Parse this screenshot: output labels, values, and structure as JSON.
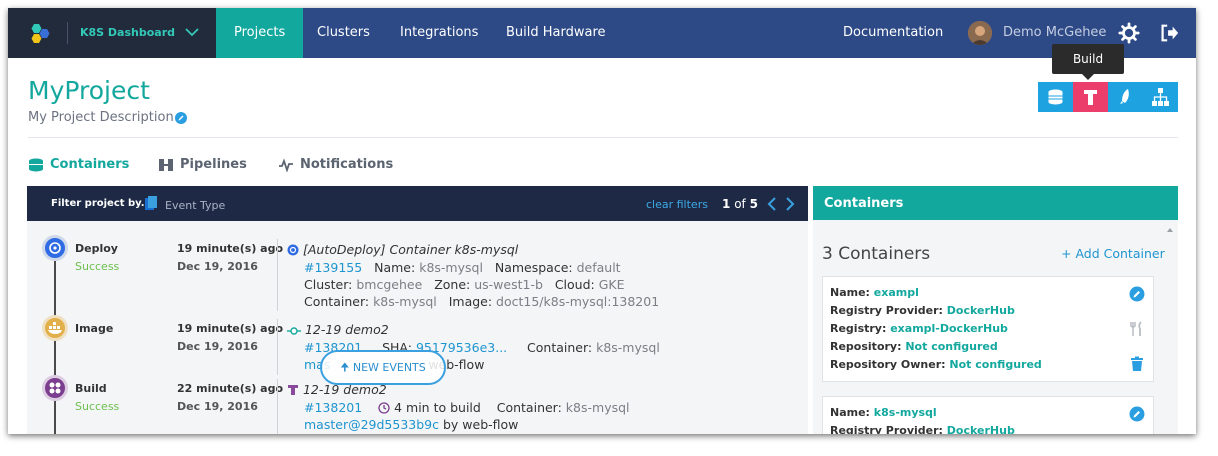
{
  "app": {
    "brand_name": "K8S Dashboard",
    "user_name": "Demo McGehee"
  },
  "nav": {
    "items": [
      {
        "label": "Projects",
        "active": true
      },
      {
        "label": "Clusters",
        "active": false
      },
      {
        "label": "Integrations",
        "active": false
      },
      {
        "label": "Build Hardware",
        "active": false
      }
    ],
    "documentation": "Documentation"
  },
  "project": {
    "title": "MyProject",
    "description": "My Project Description"
  },
  "actions": {
    "tooltip": "Build",
    "buttons": [
      "database-icon",
      "build-icon",
      "rocket-icon",
      "sitemap-icon"
    ],
    "active_button": "build-icon"
  },
  "tabs": [
    {
      "label": "Containers",
      "active": true
    },
    {
      "label": "Pipelines",
      "active": false
    },
    {
      "label": "Notifications",
      "active": false
    }
  ],
  "filter": {
    "label": "Filter project by...",
    "type": "Event Type",
    "clear": "clear filters",
    "page_current": "1",
    "page_sep": "of",
    "page_total": "5"
  },
  "events": [
    {
      "type": "Deploy",
      "status": "Success",
      "time": "19 minute(s) ago",
      "date": "Dec 19, 2016",
      "title": "[AutoDeploy] Container k8s-mysql",
      "id": "#139155",
      "name_label": "Name:",
      "name_value": "k8s-mysql",
      "namespace_label": "Namespace:",
      "namespace_value": "default",
      "cluster_label": "Cluster:",
      "cluster_value": "bmcgehee",
      "zone_label": "Zone:",
      "zone_value": "us-west1-b",
      "cloud_label": "Cloud:",
      "cloud_value": "GKE",
      "container_label": "Container:",
      "container_value": "k8s-mysql",
      "image_label": "Image:",
      "image_value": "doct15/k8s-mysql:138201"
    },
    {
      "type": "Image",
      "status": "",
      "time": "19 minute(s) ago",
      "date": "Dec 19, 2016",
      "title": "12-19 demo2",
      "id": "#138201",
      "sha_label": "SHA:",
      "sha_value": "95179536e3...",
      "container_label": "Container:",
      "container_value": "k8s-mysql",
      "branch": "mas",
      "by": "web-flow"
    },
    {
      "type": "Build",
      "status": "Success",
      "time": "22 minute(s) ago",
      "date": "Dec 19, 2016",
      "title": "12-19 demo2",
      "id": "#138201",
      "duration": "4 min to build",
      "container_label": "Container:",
      "container_value": "k8s-mysql",
      "branch": "master@29d5533b9c",
      "by": "by web-flow"
    }
  ],
  "new_events": "NEW EVENTS",
  "containers_panel": {
    "title": "Containers",
    "count": "3 Containers",
    "add": "+ Add Container",
    "cards": [
      {
        "name_label": "Name:",
        "name": "exampl",
        "provider_label": "Registry Provider:",
        "provider": "DockerHub",
        "registry_label": "Registry:",
        "registry": "exampl-DockerHub",
        "repository_label": "Repository:",
        "repository": "Not configured",
        "owner_label": "Repository Owner:",
        "owner": "Not configured"
      },
      {
        "name_label": "Name:",
        "name": "k8s-mysql",
        "provider_label": "Registry Provider:",
        "provider": "DockerHub"
      }
    ]
  },
  "colors": {
    "nav": "#2d4a87",
    "brand_bg": "#212b3b",
    "accent": "#13a89e",
    "link": "#1f95cf",
    "build_active": "#ec3e6b",
    "action_bar": "#1fa3e0",
    "success": "#6bbf4e"
  }
}
